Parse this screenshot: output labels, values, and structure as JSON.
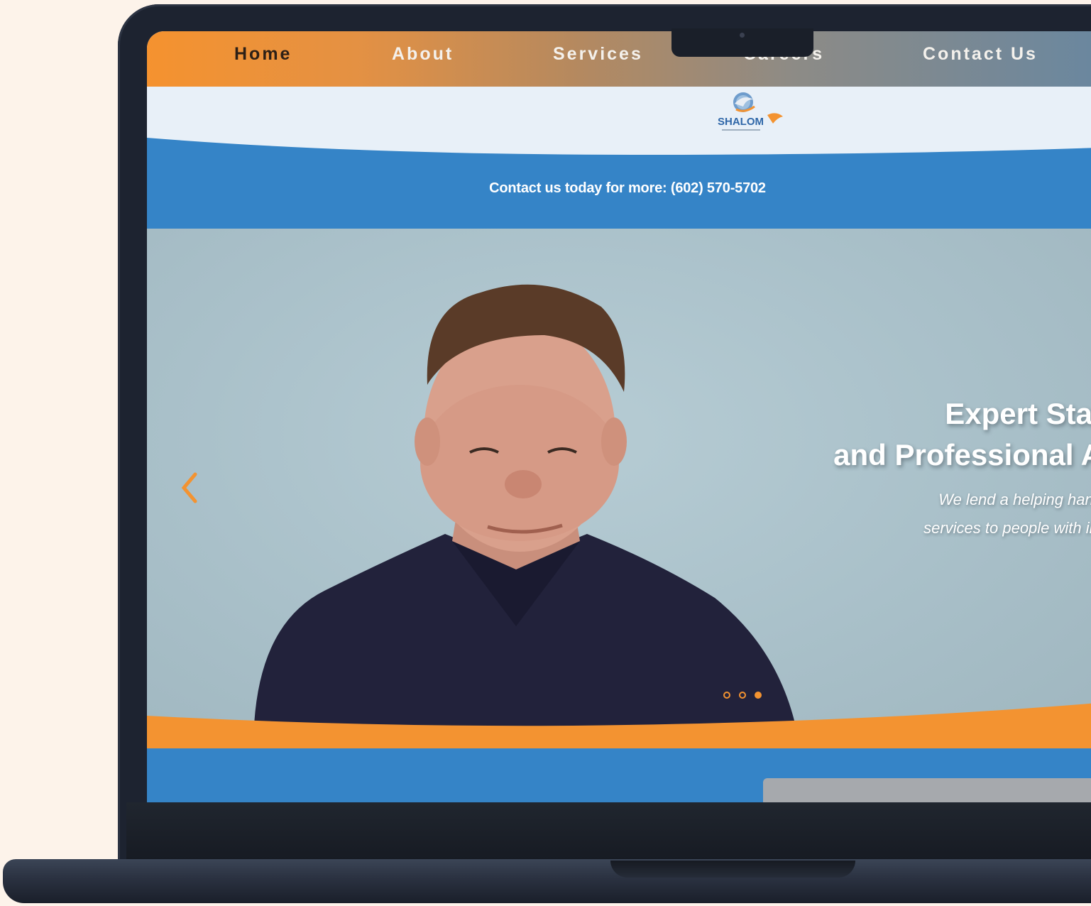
{
  "nav": {
    "items": [
      {
        "label": "Home",
        "active": true
      },
      {
        "label": "About",
        "active": false
      },
      {
        "label": "Services",
        "active": false
      },
      {
        "label": "Careers",
        "active": false
      },
      {
        "label": "Contact Us",
        "active": false
      }
    ]
  },
  "logo": {
    "text": "SHALOM"
  },
  "contact_strip": {
    "text": "Contact us today for more: (602) 570-5702"
  },
  "hero": {
    "title_line1": "Expert Staf",
    "title_line2": "and Professional A",
    "sub_line1": "We lend a helping hand",
    "sub_line2": "services to people with int",
    "slides_total": 3,
    "active_slide": 3
  },
  "colors": {
    "orange": "#f39331",
    "blue": "#3584c7",
    "nav_text_active": "#2d2016",
    "nav_text": "#f4f1ec",
    "background": "#fdf3ea"
  },
  "icons": {
    "prev": "chevron-left-icon",
    "logo": "dove-globe-icon",
    "camera": "camera-icon"
  }
}
